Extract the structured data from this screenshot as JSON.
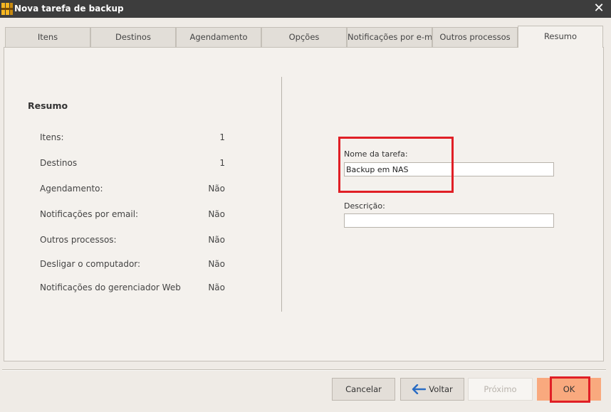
{
  "window": {
    "title": "Nova tarefa de backup",
    "close_icon": "close-icon",
    "app_icon": "backup-app-icon"
  },
  "tabs": [
    {
      "label": "Itens"
    },
    {
      "label": "Destinos"
    },
    {
      "label": "Agendamento"
    },
    {
      "label": "Opções"
    },
    {
      "label": "Notificações por e-mail"
    },
    {
      "label": "Outros processos"
    },
    {
      "label": "Resumo",
      "active": true
    }
  ],
  "summary": {
    "title": "Resumo",
    "rows": [
      {
        "label": "Itens:",
        "value": "1"
      },
      {
        "label": "Destinos",
        "value": "1"
      },
      {
        "label": "Agendamento:",
        "value": "Não"
      },
      {
        "label": "Notificações por email:",
        "value": "Não"
      },
      {
        "label": "Outros processos:",
        "value": "Não"
      },
      {
        "label": "Desligar o computador:",
        "value": "Não"
      },
      {
        "label": "Notificações do gerenciador Web",
        "value": "Não"
      }
    ]
  },
  "form": {
    "task_name_label": "Nome da tarefa:",
    "task_name_value": "Backup em NAS",
    "description_label": "Descrição:",
    "description_value": ""
  },
  "footer": {
    "cancel_label": "Cancelar",
    "back_label": "Voltar",
    "next_label": "Próximo",
    "ok_label": "OK"
  },
  "colors": {
    "titlebar": "#3d3d3d",
    "window_bg": "#efebe6",
    "ok_button": "#f9a97e",
    "highlight": "#e01f26"
  }
}
